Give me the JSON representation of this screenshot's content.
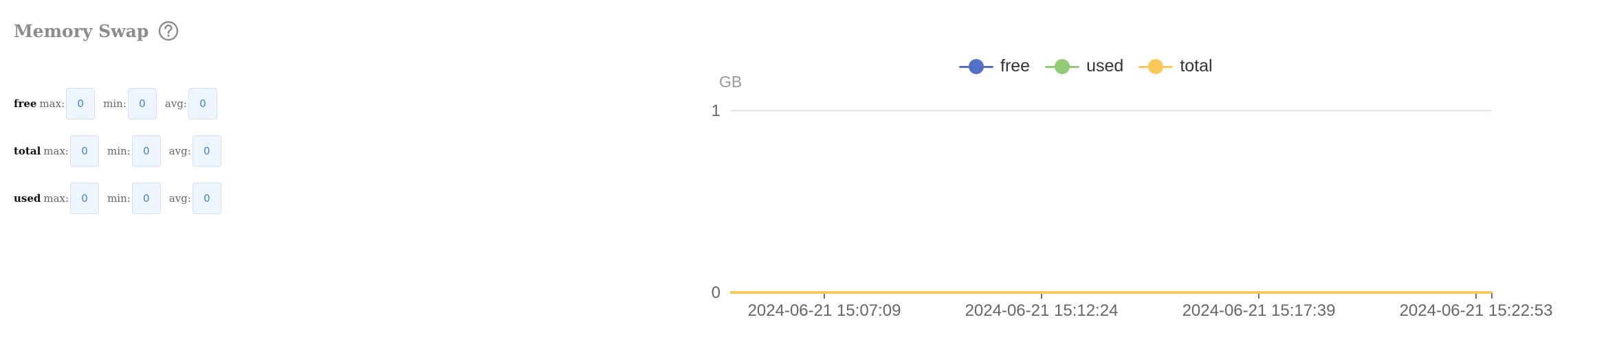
{
  "panel": {
    "title": "Memory Swap",
    "help_icon": "question-circle-icon"
  },
  "stats": [
    {
      "name": "free",
      "max_label": "max:",
      "max": "0",
      "min_label": "min:",
      "min": "0",
      "avg_label": "avg:",
      "avg": "0"
    },
    {
      "name": "total",
      "max_label": "max:",
      "max": "0",
      "min_label": "min:",
      "min": "0",
      "avg_label": "avg:",
      "avg": "0"
    },
    {
      "name": "used",
      "max_label": "max:",
      "max": "0",
      "min_label": "min:",
      "min": "0",
      "avg_label": "avg:",
      "avg": "0"
    }
  ],
  "colors": {
    "free": "#5470c6",
    "used": "#91cc75",
    "total": "#fac858",
    "axis": "#6e7079",
    "grid": "#e0e6f1"
  },
  "chart_data": {
    "type": "line",
    "ylabel": "GB",
    "ylim": [
      0,
      1
    ],
    "y_ticks": [
      "0",
      "1"
    ],
    "x_ticks": [
      "2024-06-21 15:07:09",
      "2024-06-21 15:12:24",
      "2024-06-21 15:17:39",
      "2024-06-21 15:22:53"
    ],
    "legend_position": "top-center",
    "grid": true,
    "series": [
      {
        "name": "free",
        "values": [
          0,
          0,
          0,
          0
        ]
      },
      {
        "name": "used",
        "values": [
          0,
          0,
          0,
          0
        ]
      },
      {
        "name": "total",
        "values": [
          0,
          0,
          0,
          0
        ]
      }
    ]
  }
}
